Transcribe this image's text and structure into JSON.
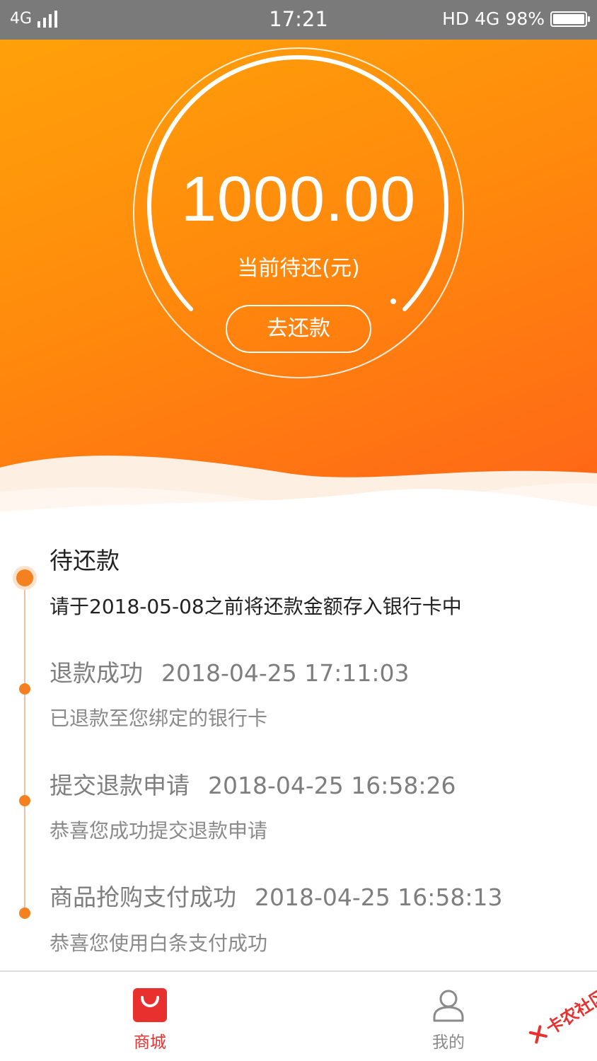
{
  "status_bar": {
    "network_left": "4G",
    "time": "17:21",
    "hd": "HD",
    "network_right": "4G",
    "battery": "98%"
  },
  "hero": {
    "amount": "1000.00",
    "amount_label": "当前待还(元)",
    "repay_button": "去还款"
  },
  "timeline": [
    {
      "title": "待还款",
      "date": "",
      "desc": "请于2018-05-08之前将还款金额存入银行卡中"
    },
    {
      "title": "退款成功",
      "date": "2018-04-25 17:11:03",
      "desc": "已退款至您绑定的银行卡"
    },
    {
      "title": "提交退款申请",
      "date": "2018-04-25 16:58:26",
      "desc": "恭喜您成功提交退款申请"
    },
    {
      "title": "商品抢购支付成功",
      "date": "2018-04-25 16:58:13",
      "desc": "恭喜您使用白条支付成功"
    }
  ],
  "tabbar": {
    "mall_label": "商城",
    "mine_label": "我的"
  },
  "watermark": "卡农社区",
  "colors": {
    "accent_orange": "#f4801f",
    "tab_active": "#e8312f",
    "status_bar": "#7a7a7a"
  }
}
